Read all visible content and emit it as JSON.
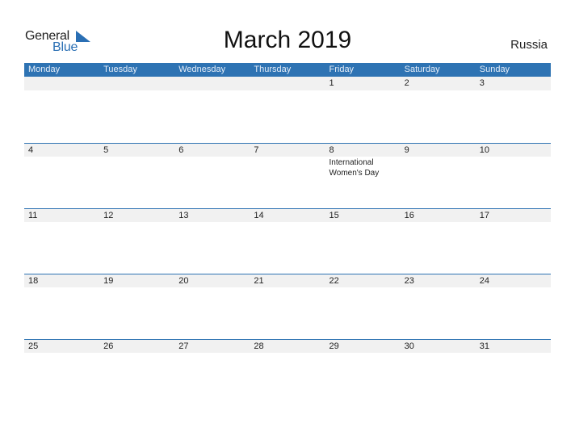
{
  "logo": {
    "word1": "General",
    "word2": "Blue",
    "accent": "#2a6fb4"
  },
  "title": "March 2019",
  "country": "Russia",
  "colors": {
    "header_bg": "#2e73b3",
    "row_bg": "#f1f1f1"
  },
  "weekdays": [
    "Monday",
    "Tuesday",
    "Wednesday",
    "Thursday",
    "Friday",
    "Saturday",
    "Sunday"
  ],
  "weeks": [
    {
      "days": [
        "",
        "",
        "",
        "",
        "1",
        "2",
        "3"
      ],
      "events": [
        "",
        "",
        "",
        "",
        "",
        "",
        ""
      ]
    },
    {
      "days": [
        "4",
        "5",
        "6",
        "7",
        "8",
        "9",
        "10"
      ],
      "events": [
        "",
        "",
        "",
        "",
        "International Women's Day",
        "",
        ""
      ]
    },
    {
      "days": [
        "11",
        "12",
        "13",
        "14",
        "15",
        "16",
        "17"
      ],
      "events": [
        "",
        "",
        "",
        "",
        "",
        "",
        ""
      ]
    },
    {
      "days": [
        "18",
        "19",
        "20",
        "21",
        "22",
        "23",
        "24"
      ],
      "events": [
        "",
        "",
        "",
        "",
        "",
        "",
        ""
      ]
    },
    {
      "days": [
        "25",
        "26",
        "27",
        "28",
        "29",
        "30",
        "31"
      ],
      "events": [
        "",
        "",
        "",
        "",
        "",
        "",
        ""
      ]
    }
  ]
}
